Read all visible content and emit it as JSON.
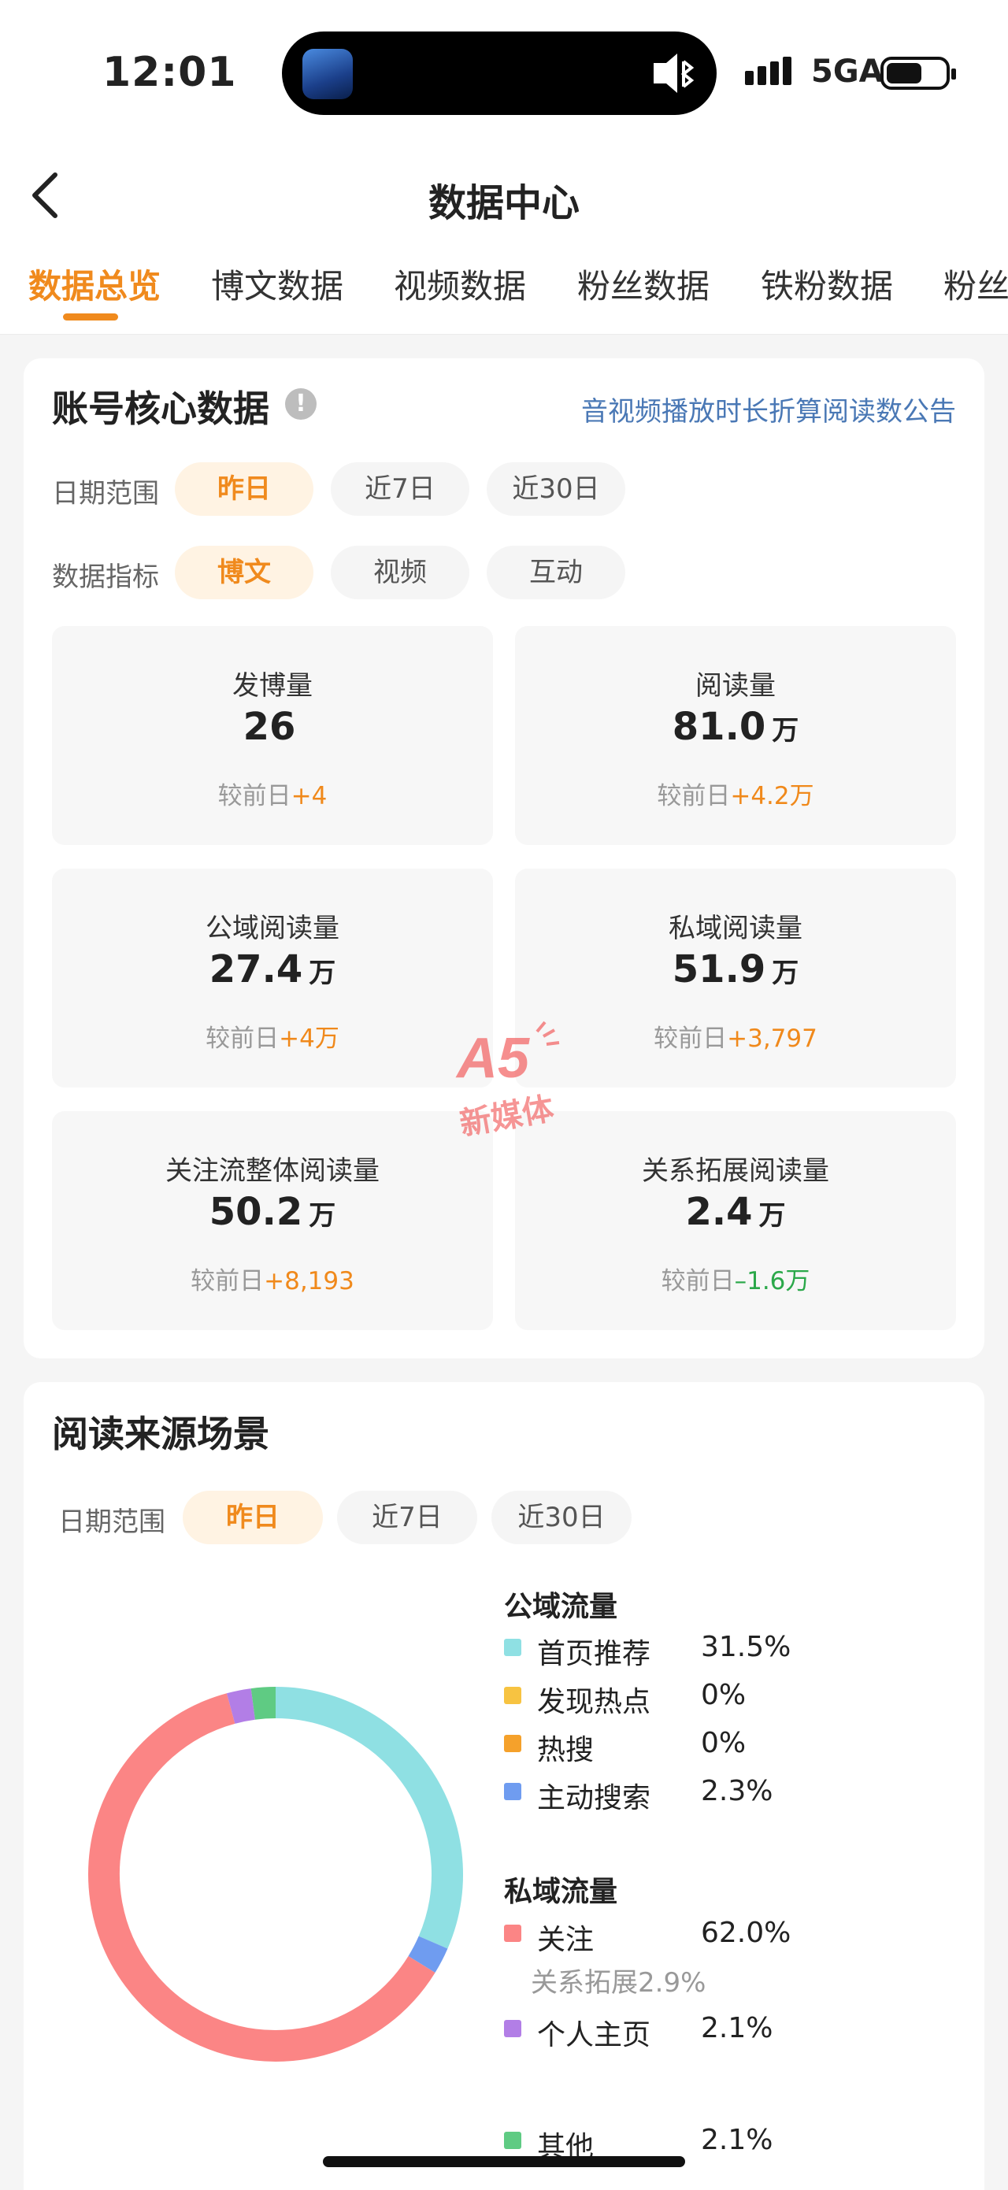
{
  "status_bar": {
    "time": "12:01",
    "network": "5GA"
  },
  "header": {
    "title": "数据中心"
  },
  "tabs": [
    {
      "label": "数据总览",
      "active": true
    },
    {
      "label": "博文数据"
    },
    {
      "label": "视频数据"
    },
    {
      "label": "粉丝数据"
    },
    {
      "label": "铁粉数据"
    },
    {
      "label": "粉丝"
    }
  ],
  "core": {
    "title": "账号核心数据",
    "notice": "音视频播放时长折算阅读数公告",
    "date_label": "日期范围",
    "date_options": [
      "昨日",
      "近7日",
      "近30日"
    ],
    "metric_label": "数据指标",
    "metric_options": [
      "博文",
      "视频",
      "互动"
    ],
    "compare_prefix": "较前日",
    "stats": [
      {
        "label": "发博量",
        "value": "26",
        "unit": "",
        "delta": "+4",
        "trend": "up"
      },
      {
        "label": "阅读量",
        "value": "81.0",
        "unit": "万",
        "delta": "+4.2万",
        "trend": "up"
      },
      {
        "label": "公域阅读量",
        "value": "27.4",
        "unit": "万",
        "delta": "+4万",
        "trend": "up"
      },
      {
        "label": "私域阅读量",
        "value": "51.9",
        "unit": "万",
        "delta": "+3,797",
        "trend": "up"
      },
      {
        "label": "关注流整体阅读量",
        "value": "50.2",
        "unit": "万",
        "delta": "+8,193",
        "trend": "up"
      },
      {
        "label": "关系拓展阅读量",
        "value": "2.4",
        "unit": "万",
        "delta": "–1.6万",
        "trend": "down"
      }
    ]
  },
  "watermark": {
    "line1": "A5",
    "line2": "新媒体"
  },
  "source": {
    "title": "阅读来源场景",
    "date_label": "日期范围",
    "date_options": [
      "昨日",
      "近7日",
      "近30日"
    ],
    "public_title": "公域流量",
    "private_title": "私域流量",
    "relation_sub": "关系拓展2.9%"
  },
  "chart_data": {
    "type": "pie",
    "donut": true,
    "slices": [
      {
        "label": "首页推荐",
        "value": 31.5,
        "display": "31.5%",
        "color": "#8fe0e3",
        "group": "公域流量"
      },
      {
        "label": "发现热点",
        "value": 0,
        "display": "0%",
        "color": "#f7c341",
        "group": "公域流量"
      },
      {
        "label": "热搜",
        "value": 0,
        "display": "0%",
        "color": "#f5a12b",
        "group": "公域流量"
      },
      {
        "label": "主动搜索",
        "value": 2.3,
        "display": "2.3%",
        "color": "#6f9cf0",
        "group": "公域流量"
      },
      {
        "label": "关注",
        "value": 62.0,
        "display": "62.0%",
        "color": "#fb8585",
        "group": "私域流量"
      },
      {
        "label": "个人主页",
        "value": 2.1,
        "display": "2.1%",
        "color": "#b27ee6",
        "group": "私域流量"
      },
      {
        "label": "其他",
        "value": 2.1,
        "display": "2.1%",
        "color": "#5fcb83",
        "group": ""
      }
    ]
  }
}
